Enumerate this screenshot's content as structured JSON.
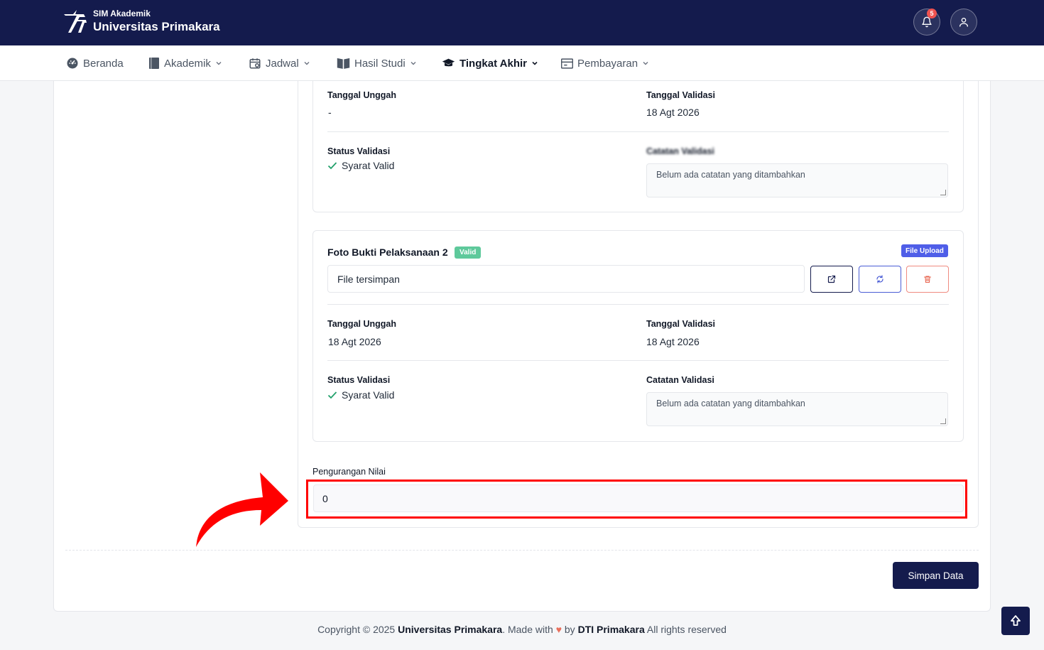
{
  "header": {
    "app_name": "SIM Akademik",
    "university": "Universitas Primakara",
    "notification_count": "5"
  },
  "nav": {
    "items": [
      {
        "label": "Beranda",
        "icon": "dashboard-icon"
      },
      {
        "label": "Akademik",
        "icon": "book-icon"
      },
      {
        "label": "Jadwal",
        "icon": "calendar-icon"
      },
      {
        "label": "Hasil Studi",
        "icon": "open-book-icon"
      },
      {
        "label": "Tingkat Akhir",
        "icon": "graduation-cap-icon"
      },
      {
        "label": "Pembayaran",
        "icon": "payment-window-icon"
      }
    ]
  },
  "doc1": {
    "upload_date_label": "Tanggal Unggah",
    "upload_date": "-",
    "validation_date_label": "Tanggal Validasi",
    "validation_date": "18 Agt 2026",
    "status_label": "Status Validasi",
    "status": "Syarat Valid",
    "note_label": "Catatan Validasi",
    "note_placeholder": "Belum ada catatan yang ditambahkan"
  },
  "doc2": {
    "title": "Foto Bukti Pelaksanaan 2",
    "valid_badge": "Valid",
    "type_badge": "File Upload",
    "file_value": "File tersimpan",
    "upload_date_label": "Tanggal Unggah",
    "upload_date": "18 Agt 2026",
    "validation_date_label": "Tanggal Validasi",
    "validation_date": "18 Agt 2026",
    "status_label": "Status Validasi",
    "status": "Syarat Valid",
    "note_label": "Catatan Validasi",
    "note_placeholder": "Belum ada catatan yang ditambahkan"
  },
  "deduction": {
    "label": "Pengurangan Nilai",
    "value": "0"
  },
  "actions": {
    "save_label": "Simpan Data"
  },
  "footer": {
    "copyright": "Copyright © 2025",
    "university": "Universitas Primakara",
    "made_with": ". Made with",
    "by": "by",
    "org": "DTI Primakara",
    "rights": "All rights reserved"
  },
  "colors": {
    "primary": "#141b4d",
    "valid": "#5ec99b",
    "info": "#4f5ee8",
    "highlight": "#ff0000"
  }
}
